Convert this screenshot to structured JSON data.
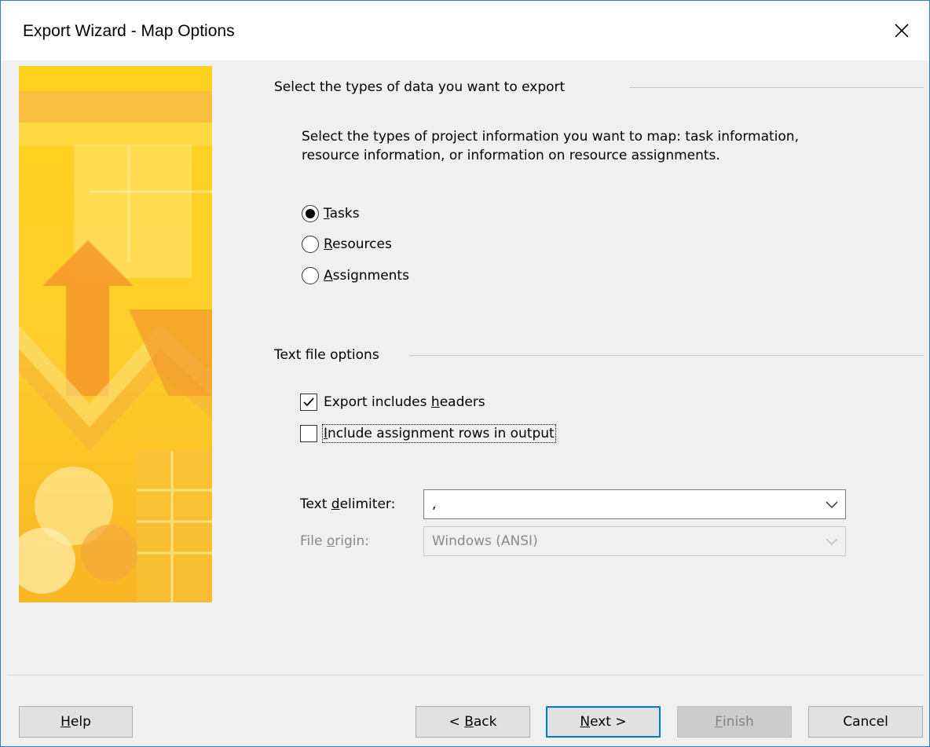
{
  "window": {
    "title": "Export Wizard - Map Options",
    "close_icon": "close-icon"
  },
  "data_types": {
    "heading": "Select the types of data you want to export",
    "description": "Select the types of project information you want to map: task information, resource information, or information on resource assignments.",
    "options": [
      {
        "mnemonic": "T",
        "rest": "asks",
        "selected": true
      },
      {
        "mnemonic": "R",
        "rest": "esources",
        "selected": false
      },
      {
        "mnemonic": "A",
        "rest": "ssignments",
        "selected": false
      }
    ]
  },
  "text_options": {
    "heading": "Text file options",
    "headers_check": {
      "before": "Export includes ",
      "mnemonic": "h",
      "after": "eaders",
      "checked": true
    },
    "assign_rows_check": {
      "before": "",
      "mnemonic": "I",
      "after": "nclude assignment rows in output",
      "checked": false
    },
    "delimiter": {
      "before": "Text ",
      "mnemonic": "d",
      "after": "elimiter:",
      "value": ","
    },
    "origin": {
      "before": "File ",
      "mnemonic": "o",
      "after": "rigin:",
      "value": "Windows (ANSI)",
      "disabled": true
    }
  },
  "buttons": {
    "help": {
      "mnemonic": "H",
      "rest": "elp"
    },
    "back": {
      "before": "< ",
      "mnemonic": "B",
      "after": "ack"
    },
    "next": {
      "mnemonic": "N",
      "after": "ext >"
    },
    "finish": {
      "mnemonic": "F",
      "after": "inish"
    },
    "cancel": "Cancel"
  },
  "colors": {
    "accent": "#0078d7",
    "banner_yellow": "#ffd21e",
    "banner_orange": "#f5a623"
  }
}
